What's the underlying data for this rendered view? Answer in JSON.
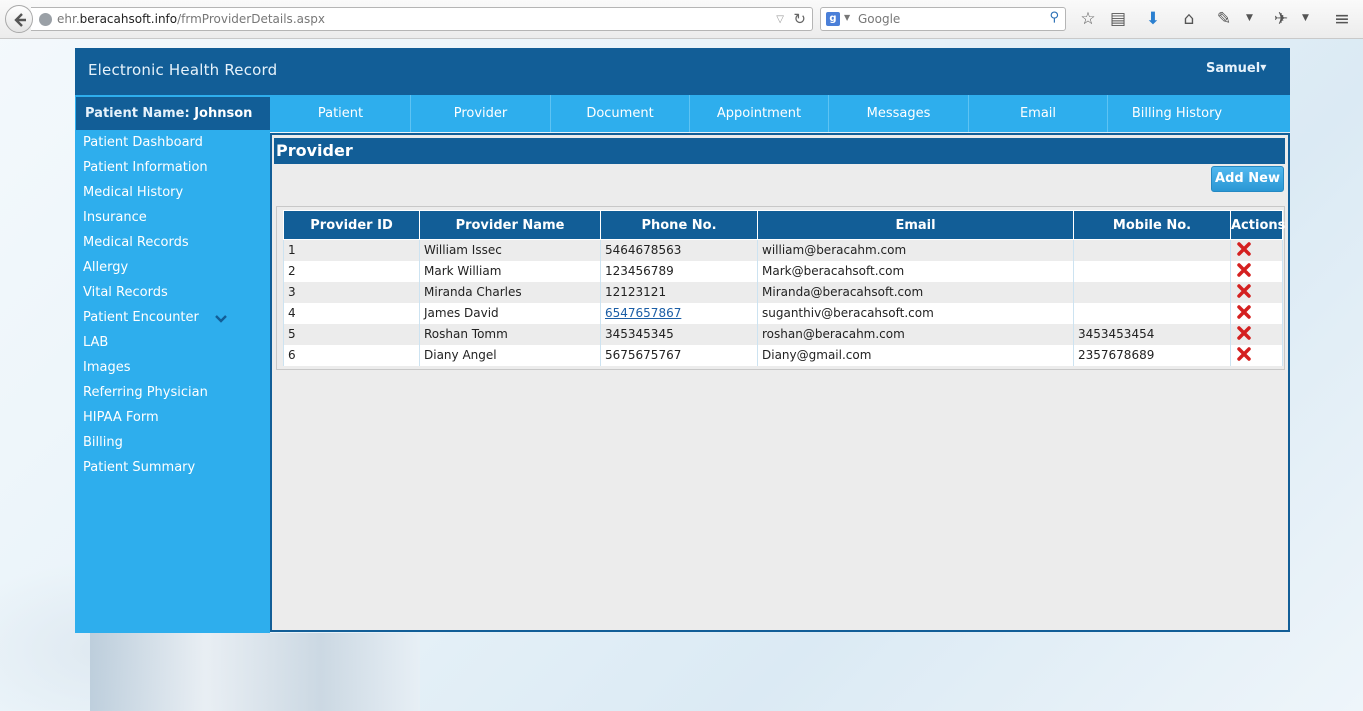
{
  "browser": {
    "url_prefix": "ehr.",
    "url_domain": "beracahsoft.info",
    "url_path": "/frmProviderDetails.aspx",
    "search_placeholder": "Google"
  },
  "app": {
    "title": "Electronic Health Record",
    "user": "Samuel",
    "accent_dark": "#125e97",
    "accent_light": "#2eaeed"
  },
  "patient": {
    "label": "Patient Name:",
    "name": "Johnson"
  },
  "nav_tabs": [
    {
      "label": "Patient"
    },
    {
      "label": "Provider"
    },
    {
      "label": "Document"
    },
    {
      "label": "Appointment"
    },
    {
      "label": "Messages"
    },
    {
      "label": "Email"
    },
    {
      "label": "Billing History"
    }
  ],
  "sidebar": {
    "items": [
      {
        "label": "Patient Dashboard"
      },
      {
        "label": "Patient Information"
      },
      {
        "label": "Medical History"
      },
      {
        "label": "Insurance"
      },
      {
        "label": "Medical Records"
      },
      {
        "label": "Allergy"
      },
      {
        "label": "Vital Records"
      },
      {
        "label": "Patient Encounter"
      },
      {
        "label": "LAB"
      },
      {
        "label": "Images"
      },
      {
        "label": "Referring Physician"
      },
      {
        "label": "HIPAA Form"
      },
      {
        "label": "Billing"
      },
      {
        "label": "Patient Summary"
      }
    ]
  },
  "panel": {
    "title": "Provider",
    "add_button": "Add New"
  },
  "table": {
    "headers": [
      "Provider ID",
      "Provider Name",
      "Phone No.",
      "Email",
      "Mobile No.",
      "Actions"
    ],
    "rows": [
      {
        "id": "1",
        "name": "William Issec",
        "phone": "5464678563",
        "email": "william@beracahm.com",
        "mobile": ""
      },
      {
        "id": "2",
        "name": "Mark William",
        "phone": "123456789",
        "email": "Mark@beracahsoft.com",
        "mobile": ""
      },
      {
        "id": "3",
        "name": "Miranda Charles",
        "phone": "12123121",
        "email": "Miranda@beracahsoft.com",
        "mobile": ""
      },
      {
        "id": "4",
        "name": "James David",
        "phone": "6547657867",
        "email": "suganthiv@beracahsoft.com",
        "mobile": ""
      },
      {
        "id": "5",
        "name": "Roshan Tomm",
        "phone": "345345345",
        "email": "roshan@beracahm.com",
        "mobile": "3453453454"
      },
      {
        "id": "6",
        "name": "Diany Angel",
        "phone": "5675675767",
        "email": "Diany@gmail.com",
        "mobile": "2357678689"
      }
    ]
  }
}
